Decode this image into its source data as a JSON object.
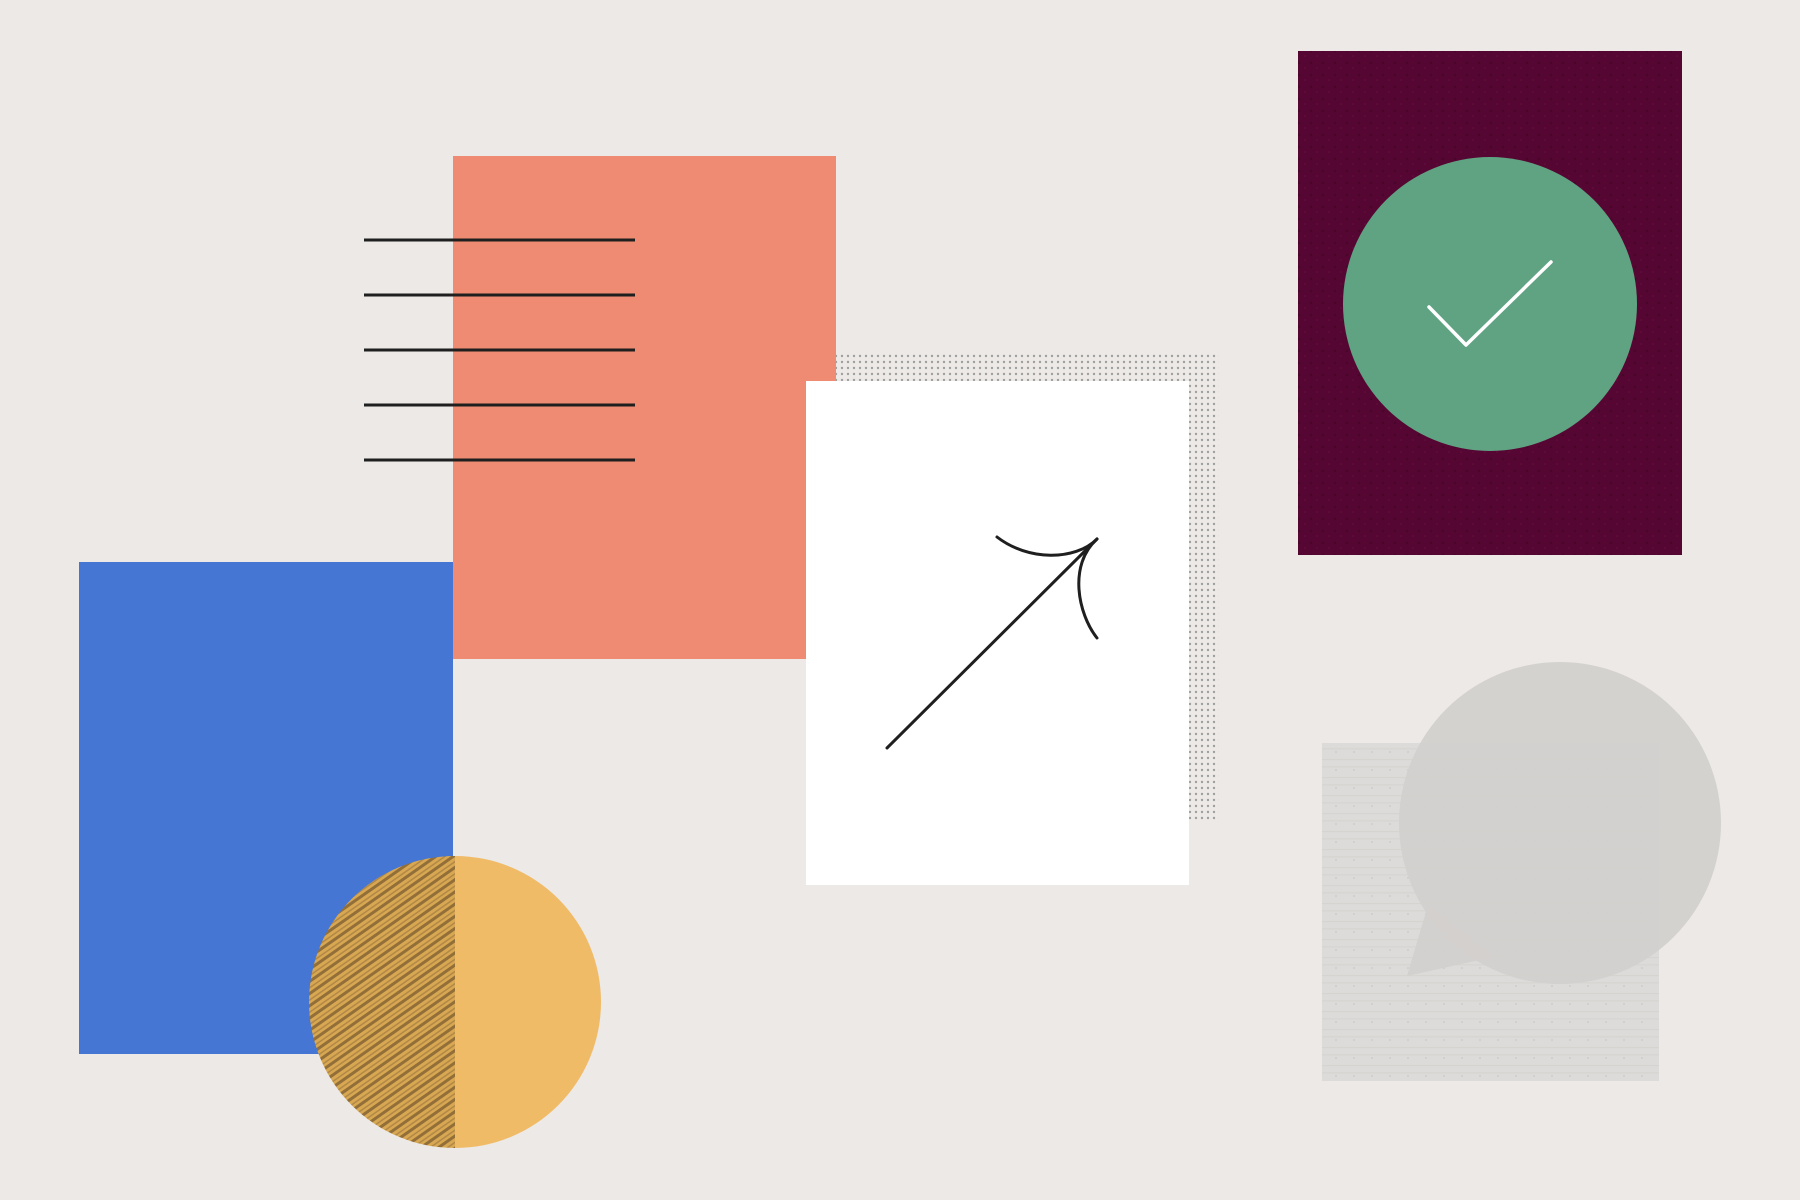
{
  "palette": {
    "background": "#ece9e6",
    "coral": "#ee8b72",
    "blue": "#4676d4",
    "white_card": "#ffffff",
    "halftone_gray": "#9a9a9a",
    "plum": "#560632",
    "green": "#5fa383",
    "mustard": "#f0bb66",
    "mustard_texture": "#7a5b2f",
    "light_gray": "#d2d0ce",
    "line_ink": "#1f1f1f"
  },
  "icons": {
    "checkmark": "check-icon",
    "arrow": "trend-up-arrow-icon",
    "speech": "speech-bubble-icon"
  }
}
